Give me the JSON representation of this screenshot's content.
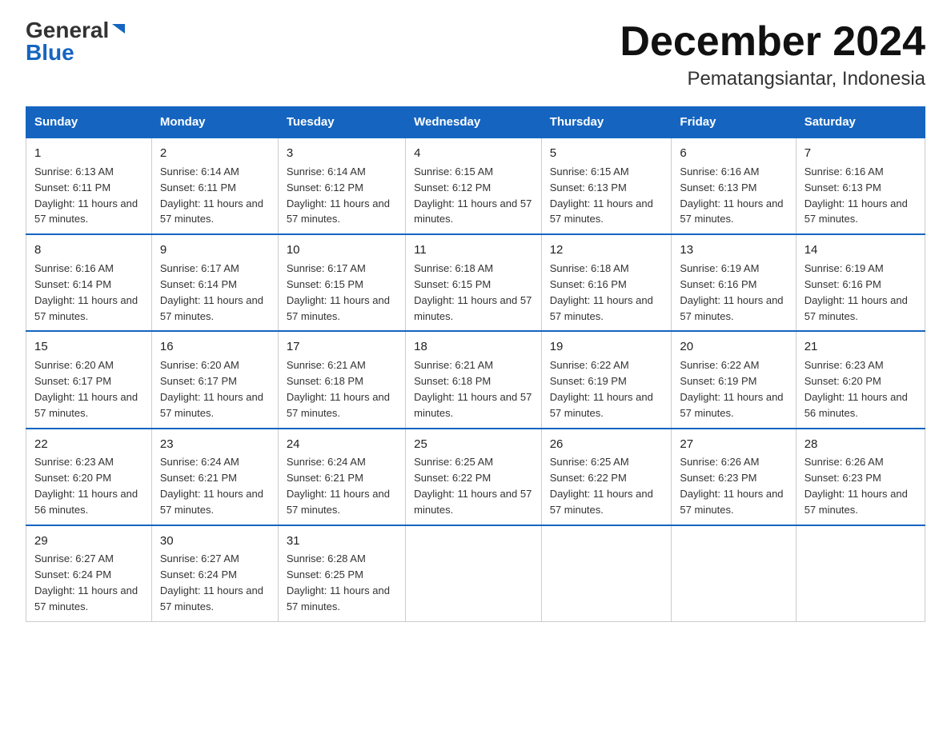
{
  "logo": {
    "general": "General",
    "blue": "Blue"
  },
  "title": "December 2024",
  "subtitle": "Pematangsiantar, Indonesia",
  "days_of_week": [
    "Sunday",
    "Monday",
    "Tuesday",
    "Wednesday",
    "Thursday",
    "Friday",
    "Saturday"
  ],
  "weeks": [
    [
      {
        "day": "1",
        "sunrise": "6:13 AM",
        "sunset": "6:11 PM",
        "daylight": "11 hours and 57 minutes."
      },
      {
        "day": "2",
        "sunrise": "6:14 AM",
        "sunset": "6:11 PM",
        "daylight": "11 hours and 57 minutes."
      },
      {
        "day": "3",
        "sunrise": "6:14 AM",
        "sunset": "6:12 PM",
        "daylight": "11 hours and 57 minutes."
      },
      {
        "day": "4",
        "sunrise": "6:15 AM",
        "sunset": "6:12 PM",
        "daylight": "11 hours and 57 minutes."
      },
      {
        "day": "5",
        "sunrise": "6:15 AM",
        "sunset": "6:13 PM",
        "daylight": "11 hours and 57 minutes."
      },
      {
        "day": "6",
        "sunrise": "6:16 AM",
        "sunset": "6:13 PM",
        "daylight": "11 hours and 57 minutes."
      },
      {
        "day": "7",
        "sunrise": "6:16 AM",
        "sunset": "6:13 PM",
        "daylight": "11 hours and 57 minutes."
      }
    ],
    [
      {
        "day": "8",
        "sunrise": "6:16 AM",
        "sunset": "6:14 PM",
        "daylight": "11 hours and 57 minutes."
      },
      {
        "day": "9",
        "sunrise": "6:17 AM",
        "sunset": "6:14 PM",
        "daylight": "11 hours and 57 minutes."
      },
      {
        "day": "10",
        "sunrise": "6:17 AM",
        "sunset": "6:15 PM",
        "daylight": "11 hours and 57 minutes."
      },
      {
        "day": "11",
        "sunrise": "6:18 AM",
        "sunset": "6:15 PM",
        "daylight": "11 hours and 57 minutes."
      },
      {
        "day": "12",
        "sunrise": "6:18 AM",
        "sunset": "6:16 PM",
        "daylight": "11 hours and 57 minutes."
      },
      {
        "day": "13",
        "sunrise": "6:19 AM",
        "sunset": "6:16 PM",
        "daylight": "11 hours and 57 minutes."
      },
      {
        "day": "14",
        "sunrise": "6:19 AM",
        "sunset": "6:16 PM",
        "daylight": "11 hours and 57 minutes."
      }
    ],
    [
      {
        "day": "15",
        "sunrise": "6:20 AM",
        "sunset": "6:17 PM",
        "daylight": "11 hours and 57 minutes."
      },
      {
        "day": "16",
        "sunrise": "6:20 AM",
        "sunset": "6:17 PM",
        "daylight": "11 hours and 57 minutes."
      },
      {
        "day": "17",
        "sunrise": "6:21 AM",
        "sunset": "6:18 PM",
        "daylight": "11 hours and 57 minutes."
      },
      {
        "day": "18",
        "sunrise": "6:21 AM",
        "sunset": "6:18 PM",
        "daylight": "11 hours and 57 minutes."
      },
      {
        "day": "19",
        "sunrise": "6:22 AM",
        "sunset": "6:19 PM",
        "daylight": "11 hours and 57 minutes."
      },
      {
        "day": "20",
        "sunrise": "6:22 AM",
        "sunset": "6:19 PM",
        "daylight": "11 hours and 57 minutes."
      },
      {
        "day": "21",
        "sunrise": "6:23 AM",
        "sunset": "6:20 PM",
        "daylight": "11 hours and 56 minutes."
      }
    ],
    [
      {
        "day": "22",
        "sunrise": "6:23 AM",
        "sunset": "6:20 PM",
        "daylight": "11 hours and 56 minutes."
      },
      {
        "day": "23",
        "sunrise": "6:24 AM",
        "sunset": "6:21 PM",
        "daylight": "11 hours and 57 minutes."
      },
      {
        "day": "24",
        "sunrise": "6:24 AM",
        "sunset": "6:21 PM",
        "daylight": "11 hours and 57 minutes."
      },
      {
        "day": "25",
        "sunrise": "6:25 AM",
        "sunset": "6:22 PM",
        "daylight": "11 hours and 57 minutes."
      },
      {
        "day": "26",
        "sunrise": "6:25 AM",
        "sunset": "6:22 PM",
        "daylight": "11 hours and 57 minutes."
      },
      {
        "day": "27",
        "sunrise": "6:26 AM",
        "sunset": "6:23 PM",
        "daylight": "11 hours and 57 minutes."
      },
      {
        "day": "28",
        "sunrise": "6:26 AM",
        "sunset": "6:23 PM",
        "daylight": "11 hours and 57 minutes."
      }
    ],
    [
      {
        "day": "29",
        "sunrise": "6:27 AM",
        "sunset": "6:24 PM",
        "daylight": "11 hours and 57 minutes."
      },
      {
        "day": "30",
        "sunrise": "6:27 AM",
        "sunset": "6:24 PM",
        "daylight": "11 hours and 57 minutes."
      },
      {
        "day": "31",
        "sunrise": "6:28 AM",
        "sunset": "6:25 PM",
        "daylight": "11 hours and 57 minutes."
      },
      null,
      null,
      null,
      null
    ]
  ]
}
